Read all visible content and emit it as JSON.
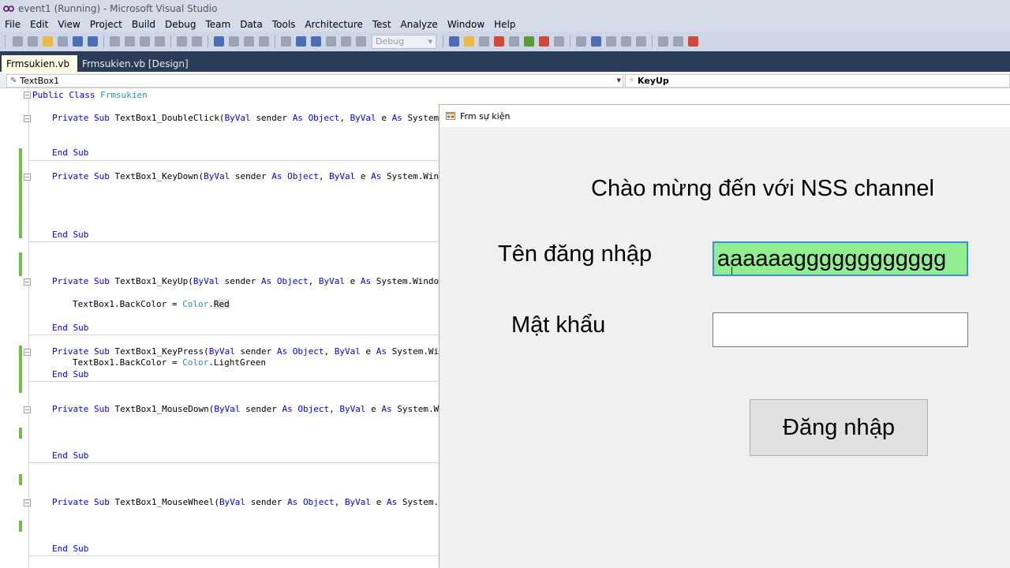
{
  "window": {
    "title": "event1 (Running) - Microsoft Visual Studio"
  },
  "menu": [
    "File",
    "Edit",
    "View",
    "Project",
    "Build",
    "Debug",
    "Team",
    "Data",
    "Tools",
    "Architecture",
    "Test",
    "Analyze",
    "Window",
    "Help"
  ],
  "toolbar": {
    "configuration": "Debug"
  },
  "tabs": [
    {
      "label": "Frmsukien.vb",
      "close": "×"
    },
    {
      "label": "Frmsukien.vb [Design]"
    }
  ],
  "nav": {
    "object": "TextBox1",
    "event": "KeyUp"
  },
  "code": {
    "l1_kw": "Public Class",
    "l1_name": "Frmsukien",
    "sub": "Private Sub",
    "byval": "ByVal",
    "sender": "sender",
    "as": "As",
    "object": "Object",
    "e": "e",
    "ds_name": "TextBox1_DoubleClick(",
    "ds_tail": "System.E",
    "kd_name": "TextBox1_KeyDown(",
    "kd_tail": "System.Windo",
    "ku_name": "TextBox1_KeyUp(",
    "ku_tail": "System.Windows",
    "kp_name": "TextBox1_KeyPress(",
    "kp_tail": "System.Wind",
    "md_name": "TextBox1_MouseDown(",
    "md_tail": "System.Wir",
    "mw_name": "TextBox1_MouseWheel(",
    "mw_tail": "System.Wi",
    "endsub": "End Sub",
    "ku_body_pre": "TextBox1.BackColor = ",
    "color": "Color",
    "ku_body_val": "Red",
    "kp_body_pre": "TextBox1.BackColor = ",
    "kp_body_val": "LightGreen",
    "dot": "."
  },
  "form": {
    "title": "Frm sự kiện",
    "welcome": "Chào mừng đến với NSS channel",
    "username_label": "Tên đăng nhập",
    "username_value": "aaaaaagggggggggggg",
    "password_label": "Mật khẩu",
    "password_value": "",
    "login_button": "Đăng nhập"
  },
  "colors": {
    "accent_tab_bg": "#2b3c59",
    "textbox_bg": "#90ee90"
  }
}
